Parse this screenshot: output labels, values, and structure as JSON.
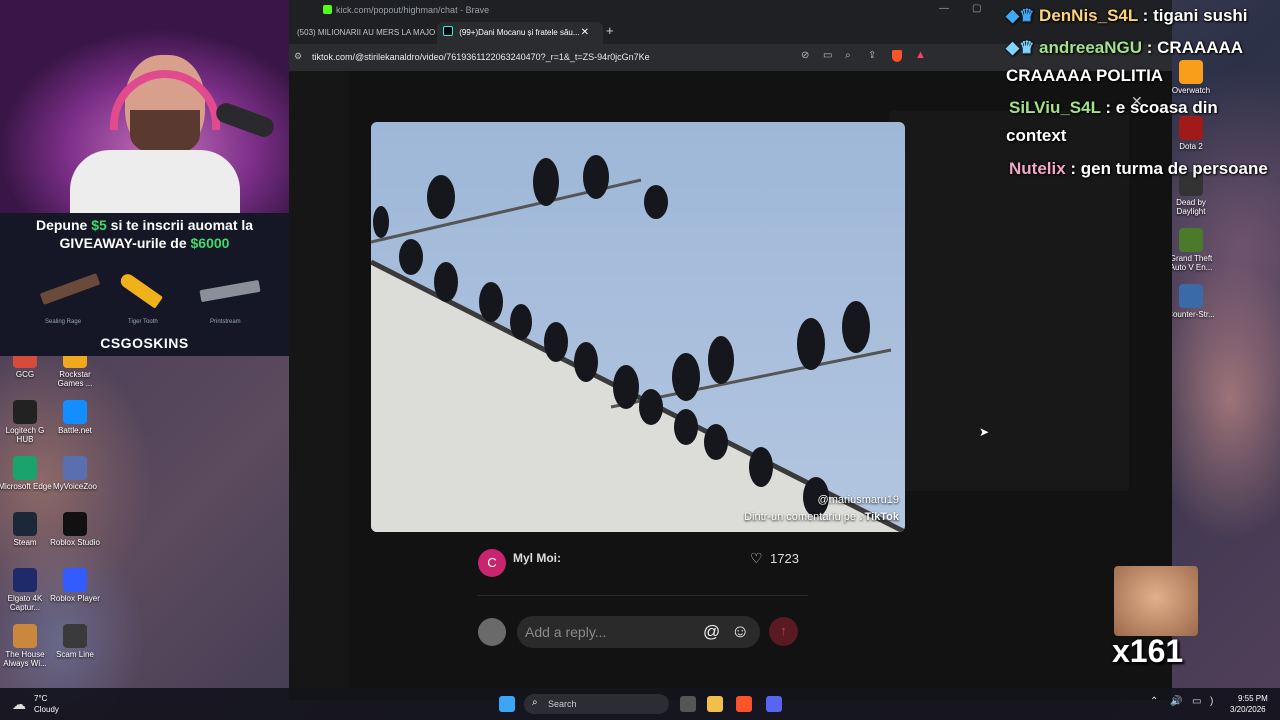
{
  "browser": {
    "window_title": "kick.com/popout/highman/chat - Brave",
    "tabs": [
      {
        "label": "(503) MILIONARII AU MERS LA MAJO"
      },
      {
        "label": "(99+)Dani Mocanu și fratele său..."
      }
    ],
    "new_tab_label": "+",
    "url": "tiktok.com/@stirilekanaldro/video/7619361122063240470?_r=1&_t=ZS-94r0jcGn7Ke"
  },
  "video": {
    "watermark_user": "@mariusmaru19",
    "watermark_caption": "Dintr-un comentariu pe",
    "watermark_brand": "TikTok"
  },
  "comment": {
    "avatar_letter": "C",
    "author": "Myl Moi:",
    "likes": "1723",
    "reply_placeholder": "Add a reply...",
    "mention_symbol": "@"
  },
  "ad": {
    "line1_pre": "Depune ",
    "line1_amount": "$5",
    "line1_post": " si te inscrii auomat la",
    "line2_pre": "GIVEAWAY-urile de ",
    "line2_amount": "$6000",
    "skin_labels": [
      "Sealing Rage",
      "Tiger Tooth",
      "Printstream"
    ],
    "brand": "CSGOSKINS"
  },
  "chat": [
    {
      "user": "DenNis_S4L",
      "sep": " : ",
      "text": "tigani sushi",
      "color": "#ffd37a"
    },
    {
      "user": "andreeaNGU",
      "sep": " : ",
      "text": "CRAAAAA",
      "color": "#a5e08a"
    },
    {
      "user": "",
      "sep": "",
      "text": "CRAAAAA POLITIA",
      "color": "#ffffff"
    },
    {
      "user": "SiLViu_S4L",
      "sep": " : ",
      "text": "e scoasa din",
      "color": "#a5e08a"
    },
    {
      "user": "",
      "sep": "",
      "text": "context",
      "color": "#ffffff"
    },
    {
      "user": "Nutelix",
      "sep": " : ",
      "text": "gen turma de persoane",
      "color": "#f4a7c8"
    }
  ],
  "emote_counter": "x161",
  "desktop_icons_left": [
    {
      "label": "GCG",
      "color": "#d84a3a"
    },
    {
      "label": "Rockstar Games ...",
      "color": "#f2a81d"
    },
    {
      "label": "Logitech G HUB",
      "color": "#222"
    },
    {
      "label": "Battle.net",
      "color": "#148eff"
    },
    {
      "label": "Microsoft Edge",
      "color": "#1aa36b"
    },
    {
      "label": "MyVoiceZoo",
      "color": "#5b6fb0"
    },
    {
      "label": "Steam",
      "color": "#1b2838"
    },
    {
      "label": "Roblox Studio",
      "color": "#111"
    },
    {
      "label": "Elgato 4K Captur...",
      "color": "#1f2a6b"
    },
    {
      "label": "Roblox Player",
      "color": "#335cff"
    },
    {
      "label": "The House Always Wi...",
      "color": "#c9883e"
    },
    {
      "label": "Scam Line",
      "color": "#3a3a3a"
    }
  ],
  "desktop_icons_right": [
    {
      "label": "Overwatch",
      "color": "#f99e1a"
    },
    {
      "label": "Dota 2",
      "color": "#a11a1a"
    },
    {
      "label": "Dead by Daylight",
      "color": "#333"
    },
    {
      "label": "Grand Theft Auto V En...",
      "color": "#4a7a2a"
    },
    {
      "label": "Counter-Str...",
      "color": "#3a6aa8"
    }
  ],
  "weather": {
    "temp": "7°C",
    "condition": "Cloudy"
  },
  "taskbar": {
    "search_placeholder": "Search"
  },
  "clock": {
    "time": "9:55 PM",
    "date": "3/20/2026"
  }
}
